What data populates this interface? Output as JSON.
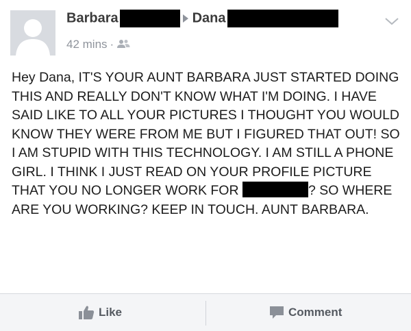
{
  "post": {
    "author": "Barbara",
    "recipient": "Dana",
    "timestamp": "42 mins",
    "separator": "·",
    "audience_icon": "friends-icon",
    "body_before_redaction": "Hey Dana, IT'S YOUR AUNT BARBARA JUST STARTED DOING THIS AND REALLY DON'T KNOW WHAT I'M DOING. I HAVE SAID LIKE TO ALL YOUR PICTURES I THOUGHT YOU WOULD KNOW THEY WERE FROM ME BUT I FIGURED THAT OUT! SO I AM STUPID WITH THIS TECHNOLOGY. I AM STILL A PHONE GIRL. I THINK I JUST READ ON YOUR PROFILE PICTURE THAT YOU NO LONGER WORK FOR",
    "body_after_redaction": "? SO WHERE ARE YOU WORKING? KEEP IN TOUCH. AUNT BARBARA."
  },
  "actions": {
    "like_label": "Like",
    "comment_label": "Comment"
  },
  "colors": {
    "text": "#1c1c1c",
    "name": "#3b3b3b",
    "meta": "#8f949c",
    "action_bar_bg": "#f4f5f7",
    "avatar_bg": "#d8dbe0"
  }
}
